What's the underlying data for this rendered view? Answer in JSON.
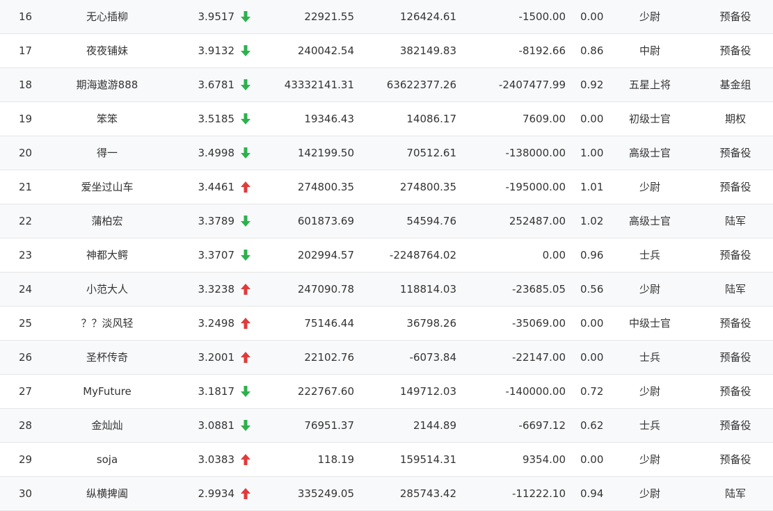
{
  "colors": {
    "up": "#e03b3b",
    "down": "#2db14e",
    "row_alt": "#f8f9fb",
    "text": "#333333"
  },
  "rows": [
    {
      "rank": "16",
      "name": "无心插柳",
      "score": "3.9517",
      "trend": "down",
      "v1": "22921.55",
      "v2": "126424.61",
      "v3": "-1500.00",
      "ratio": "0.00",
      "level": "少尉",
      "group": "预备役"
    },
    {
      "rank": "17",
      "name": "夜夜铺妹",
      "score": "3.9132",
      "trend": "down",
      "v1": "240042.54",
      "v2": "382149.83",
      "v3": "-8192.66",
      "ratio": "0.86",
      "level": "中尉",
      "group": "预备役"
    },
    {
      "rank": "18",
      "name": "期海遨游888",
      "score": "3.6781",
      "trend": "down",
      "v1": "43332141.31",
      "v2": "63622377.26",
      "v3": "-2407477.99",
      "ratio": "0.92",
      "level": "五星上将",
      "group": "基金组"
    },
    {
      "rank": "19",
      "name": "笨笨",
      "score": "3.5185",
      "trend": "down",
      "v1": "19346.43",
      "v2": "14086.17",
      "v3": "7609.00",
      "ratio": "0.00",
      "level": "初级士官",
      "group": "期权"
    },
    {
      "rank": "20",
      "name": "得一",
      "score": "3.4998",
      "trend": "down",
      "v1": "142199.50",
      "v2": "70512.61",
      "v3": "-138000.00",
      "ratio": "1.00",
      "level": "高级士官",
      "group": "预备役"
    },
    {
      "rank": "21",
      "name": "爱坐过山车",
      "score": "3.4461",
      "trend": "up",
      "v1": "274800.35",
      "v2": "274800.35",
      "v3": "-195000.00",
      "ratio": "1.01",
      "level": "少尉",
      "group": "预备役"
    },
    {
      "rank": "22",
      "name": "蒲柏宏",
      "score": "3.3789",
      "trend": "down",
      "v1": "601873.69",
      "v2": "54594.76",
      "v3": "252487.00",
      "ratio": "1.02",
      "level": "高级士官",
      "group": "陆军"
    },
    {
      "rank": "23",
      "name": "神都大鳄",
      "score": "3.3707",
      "trend": "down",
      "v1": "202994.57",
      "v2": "-2248764.02",
      "v3": "0.00",
      "ratio": "0.96",
      "level": "士兵",
      "group": "预备役"
    },
    {
      "rank": "24",
      "name": "小范大人",
      "score": "3.3238",
      "trend": "up",
      "v1": "247090.78",
      "v2": "118814.03",
      "v3": "-23685.05",
      "ratio": "0.56",
      "level": "少尉",
      "group": "陆军"
    },
    {
      "rank": "25",
      "name": "？？淡风轻",
      "score": "3.2498",
      "trend": "up",
      "v1": "75146.44",
      "v2": "36798.26",
      "v3": "-35069.00",
      "ratio": "0.00",
      "level": "中级士官",
      "group": "预备役"
    },
    {
      "rank": "26",
      "name": "圣杯传奇",
      "score": "3.2001",
      "trend": "up",
      "v1": "22102.76",
      "v2": "-6073.84",
      "v3": "-22147.00",
      "ratio": "0.00",
      "level": "士兵",
      "group": "预备役"
    },
    {
      "rank": "27",
      "name": "MyFuture",
      "score": "3.1817",
      "trend": "down",
      "v1": "222767.60",
      "v2": "149712.03",
      "v3": "-140000.00",
      "ratio": "0.72",
      "level": "少尉",
      "group": "预备役"
    },
    {
      "rank": "28",
      "name": "金灿灿",
      "score": "3.0881",
      "trend": "down",
      "v1": "76951.37",
      "v2": "2144.89",
      "v3": "-6697.12",
      "ratio": "0.62",
      "level": "士兵",
      "group": "预备役"
    },
    {
      "rank": "29",
      "name": "soja",
      "score": "3.0383",
      "trend": "up",
      "v1": "118.19",
      "v2": "159514.31",
      "v3": "9354.00",
      "ratio": "0.00",
      "level": "少尉",
      "group": "预备役"
    },
    {
      "rank": "30",
      "name": "纵横捭阖",
      "score": "2.9934",
      "trend": "up",
      "v1": "335249.05",
      "v2": "285743.42",
      "v3": "-11222.10",
      "ratio": "0.94",
      "level": "少尉",
      "group": "陆军"
    }
  ]
}
